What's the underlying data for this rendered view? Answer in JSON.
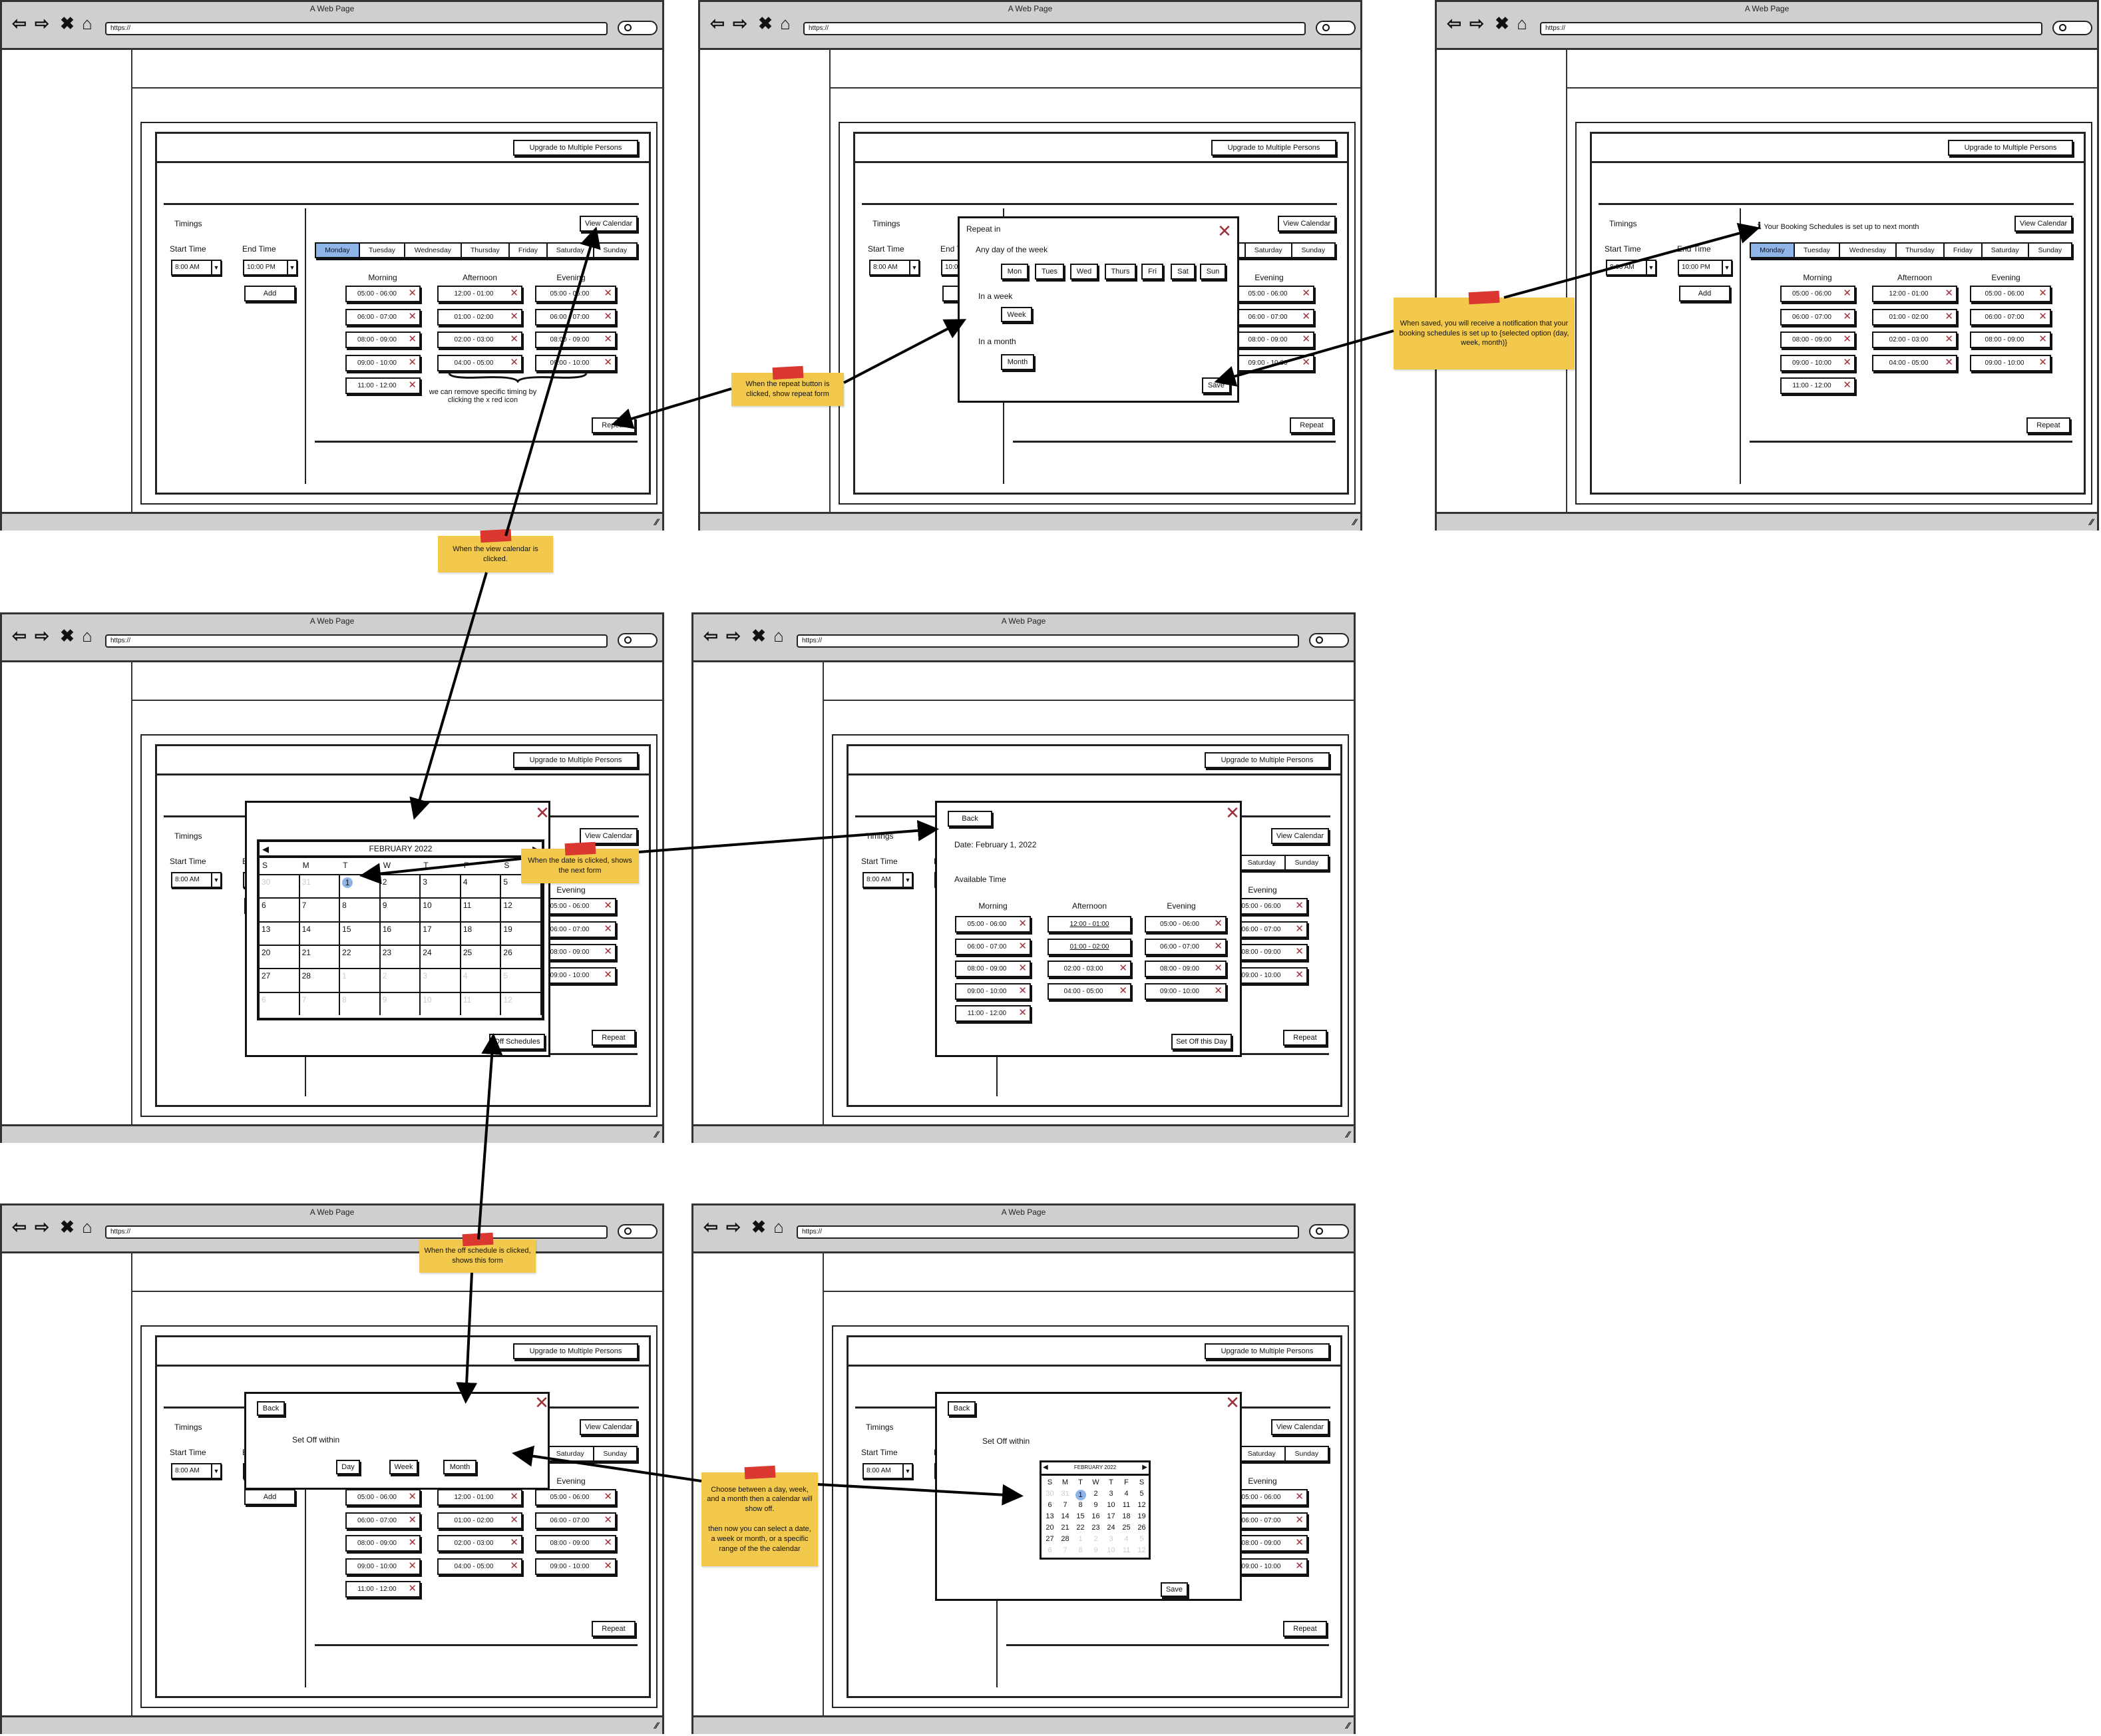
{
  "browser": {
    "title": "A Web Page",
    "url": "https://"
  },
  "schedule": {
    "upgrade": "Upgrade to Multiple Persons",
    "timings": "Timings",
    "start_label": "Start Time",
    "start_value": "8:00 AM",
    "end_label": "End Time",
    "end_value": "10:00 PM",
    "add": "Add",
    "view_calendar": "View Calendar",
    "tabs": [
      "Monday",
      "Tuesday",
      "Wednesday",
      "Thursday",
      "Friday",
      "Saturday",
      "Sunday"
    ],
    "active_tab": "Monday",
    "periods": [
      "Morning",
      "Afternoon",
      "Evening"
    ],
    "morning": [
      "05:00 - 06:00",
      "06:00 - 07:00",
      "08:00 - 09:00",
      "09:00 - 10:00",
      "11:00 - 12:00"
    ],
    "afternoon": [
      "12:00 - 01:00",
      "01:00 - 02:00",
      "02:00 - 03:00",
      "04:00 - 05:00"
    ],
    "evening": [
      "05:00 - 06:00",
      "06:00 - 07:00",
      "08:00 - 09:00",
      "09:00 - 10:00"
    ],
    "repeat": "Repeat",
    "remove_hint": "we can remove specific timing by clicking the x red icon"
  },
  "notification": "Your Booking Schedules is set up to next month",
  "repeat_form": {
    "title": "Repeat in",
    "any_day": "Any day of the week",
    "days": [
      "Mon",
      "Tues",
      "Wed",
      "Thurs",
      "Fri",
      "Sat",
      "Sun"
    ],
    "in_week": "In a week",
    "week": "Week",
    "in_month": "In a month",
    "month": "Month",
    "save": "Save"
  },
  "calendar": {
    "month": "FEBRUARY 2022",
    "weekdays": [
      "S",
      "M",
      "T",
      "W",
      "T",
      "F",
      "S"
    ],
    "days": [
      {
        "d": "30",
        "muted": true
      },
      {
        "d": "31",
        "muted": true
      },
      {
        "d": "1",
        "selected": true
      },
      {
        "d": "2"
      },
      {
        "d": "3"
      },
      {
        "d": "4"
      },
      {
        "d": "5"
      },
      {
        "d": "6"
      },
      {
        "d": "7"
      },
      {
        "d": "8"
      },
      {
        "d": "9"
      },
      {
        "d": "10"
      },
      {
        "d": "11"
      },
      {
        "d": "12"
      },
      {
        "d": "13"
      },
      {
        "d": "14"
      },
      {
        "d": "15"
      },
      {
        "d": "16"
      },
      {
        "d": "17"
      },
      {
        "d": "18"
      },
      {
        "d": "19"
      },
      {
        "d": "20"
      },
      {
        "d": "21"
      },
      {
        "d": "22"
      },
      {
        "d": "23"
      },
      {
        "d": "24"
      },
      {
        "d": "25"
      },
      {
        "d": "26"
      },
      {
        "d": "27"
      },
      {
        "d": "28"
      },
      {
        "d": "1",
        "muted": true
      },
      {
        "d": "2",
        "muted": true
      },
      {
        "d": "3",
        "muted": true
      },
      {
        "d": "4",
        "muted": true
      },
      {
        "d": "5",
        "muted": true
      },
      {
        "d": "6",
        "muted": true
      },
      {
        "d": "7",
        "muted": true
      },
      {
        "d": "8",
        "muted": true
      },
      {
        "d": "9",
        "muted": true
      },
      {
        "d": "10",
        "muted": true
      },
      {
        "d": "11",
        "muted": true
      },
      {
        "d": "12",
        "muted": true
      }
    ],
    "off_schedules": "Off Schedules"
  },
  "day_detail": {
    "back": "Back",
    "date": "Date: February 1, 2022",
    "available_time": "Available Time",
    "set_off": "Set Off this Day"
  },
  "set_off": {
    "back": "Back",
    "title": "Set Off within",
    "options": [
      "Day",
      "Week",
      "Month"
    ],
    "save": "Save"
  },
  "notes": [
    "When the repeat button is clicked, show repeat form",
    "When the view calendar is clicked.",
    "When saved, you will receive a notification that your booking schedules is set up to {selected option (day, week, month)}",
    "When the date is clicked, shows the next form",
    "When the off schedule is clicked, shows this form",
    "Choose between a day, week, and a month then a calendar will show off.\n\nthen now you can select a date, a week or month, or a specific range of the the calendar"
  ],
  "colors": {
    "active_tab": "#8fb4e8",
    "remove_x": "#a0303a",
    "sticky_note": "#f2c94c",
    "tape": "#d9372f"
  }
}
